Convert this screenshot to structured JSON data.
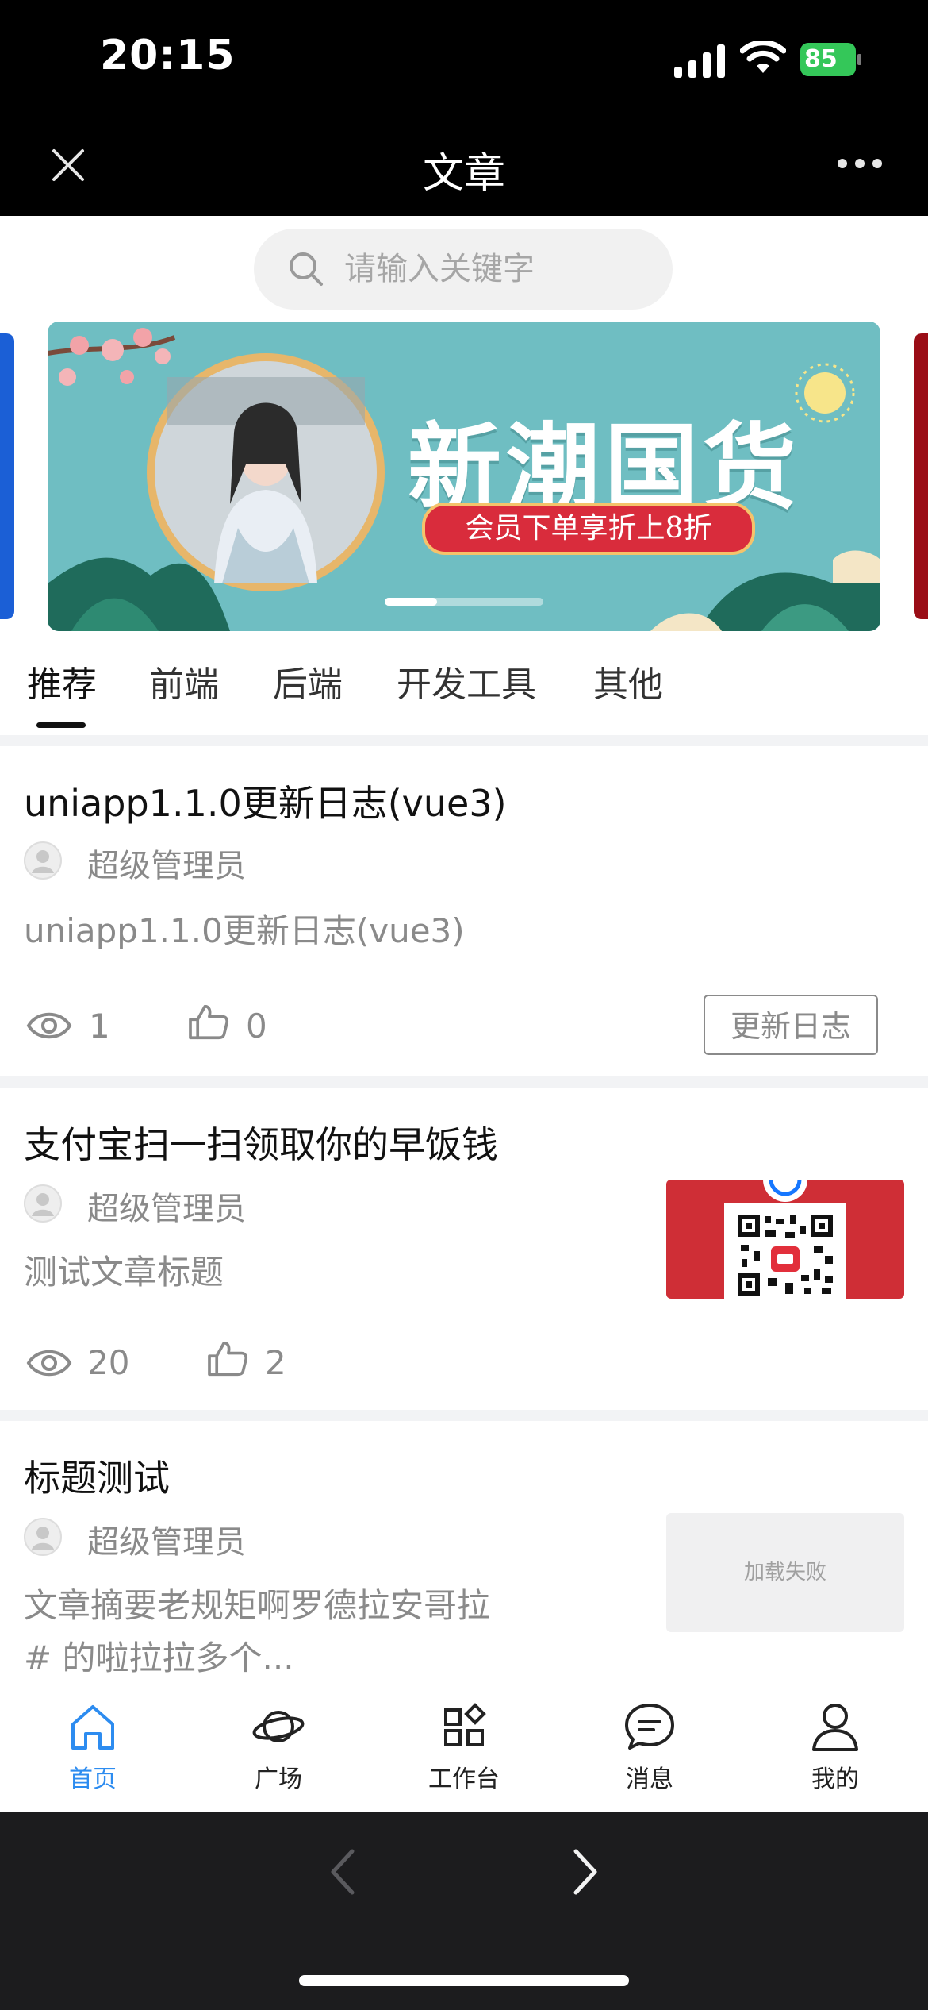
{
  "status_bar": {
    "time": "20:15",
    "battery": "85"
  },
  "header": {
    "title": "文章"
  },
  "search": {
    "placeholder": "请输入关键字"
  },
  "banner": {
    "headline": "新潮国货",
    "subtitle": "会员下单享折上8折",
    "active_slide": 1,
    "slide_count": 3
  },
  "tabs": [
    {
      "label": "推荐",
      "active": true
    },
    {
      "label": "前端"
    },
    {
      "label": "后端"
    },
    {
      "label": "开发工具"
    },
    {
      "label": "其他"
    }
  ],
  "articles": [
    {
      "title": "uniapp1.1.0更新日志(vue3)",
      "author": "超级管理员",
      "summary": "uniapp1.1.0更新日志(vue3)",
      "views": "1",
      "likes": "0",
      "tag": "更新日志"
    },
    {
      "title": "支付宝扫一扫领取你的早饭钱",
      "author": "超级管理员",
      "summary": "测试文章标题",
      "views": "20",
      "likes": "2",
      "thumbnail": "qr-code-poster"
    },
    {
      "title": "标题测试",
      "author": "超级管理员",
      "summary_line1": "文章摘要老规矩啊罗德拉安哥拉",
      "summary_line2": "# 的啦拉拉多个...",
      "thumbnail_status": "加载失败"
    }
  ],
  "tabbar": [
    {
      "label": "首页",
      "icon": "home-icon",
      "active": true
    },
    {
      "label": "广场",
      "icon": "planet-icon"
    },
    {
      "label": "工作台",
      "icon": "workbench-icon"
    },
    {
      "label": "消息",
      "icon": "message-icon"
    },
    {
      "label": "我的",
      "icon": "user-icon"
    }
  ],
  "colors": {
    "accent": "#2d8cf0",
    "banner_bg": "#6fbec2",
    "banner_red": "#d92c3c"
  }
}
